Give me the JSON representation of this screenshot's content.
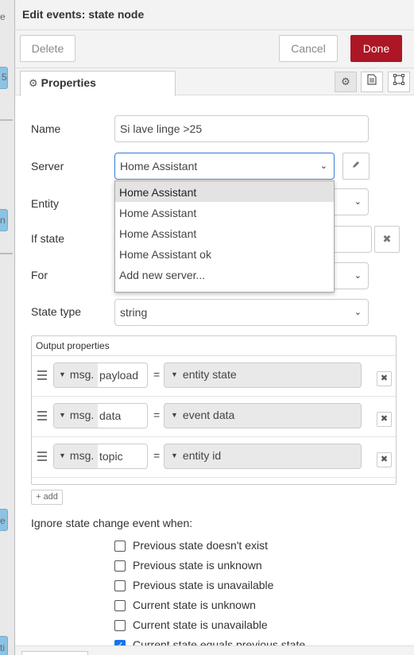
{
  "header": {
    "title": "Edit events: state node"
  },
  "toolbar": {
    "delete_label": "Delete",
    "cancel_label": "Cancel",
    "done_label": "Done",
    "done_color": "#ad1625"
  },
  "tabs": {
    "properties_label": "Properties"
  },
  "canvas": {
    "fragments": [
      "e",
      "5",
      "n",
      "e",
      "ti"
    ]
  },
  "form": {
    "name_label": "Name",
    "name_value": "Si lave linge >25",
    "server_label": "Server",
    "server_value": "Home Assistant",
    "entity_label": "Entity",
    "if_state_label": "If state",
    "for_label": "For",
    "state_type_label": "State type",
    "state_type_value": "string"
  },
  "server_dropdown": {
    "options": [
      "Home Assistant",
      "Home Assistant",
      "Home Assistant",
      "Home Assistant ok",
      "Add new server..."
    ],
    "selected_index": 0
  },
  "output_properties": {
    "title": "Output properties",
    "rows": [
      {
        "prefix": "msg.",
        "property": "payload",
        "equals": "=",
        "value": "entity state"
      },
      {
        "prefix": "msg.",
        "property": "data",
        "equals": "=",
        "value": "event data"
      },
      {
        "prefix": "msg.",
        "property": "topic",
        "equals": "=",
        "value": "entity id"
      }
    ],
    "add_label": "add"
  },
  "ignore": {
    "label": "Ignore state change event when:",
    "options": [
      {
        "text": "Previous state doesn't exist",
        "checked": false
      },
      {
        "text": "Previous state is unknown",
        "checked": false
      },
      {
        "text": "Previous state is unavailable",
        "checked": false
      },
      {
        "text": "Current state is unknown",
        "checked": false
      },
      {
        "text": "Current state is unavailable",
        "checked": false
      },
      {
        "text": "Current state equals previous state",
        "checked": true
      }
    ]
  }
}
